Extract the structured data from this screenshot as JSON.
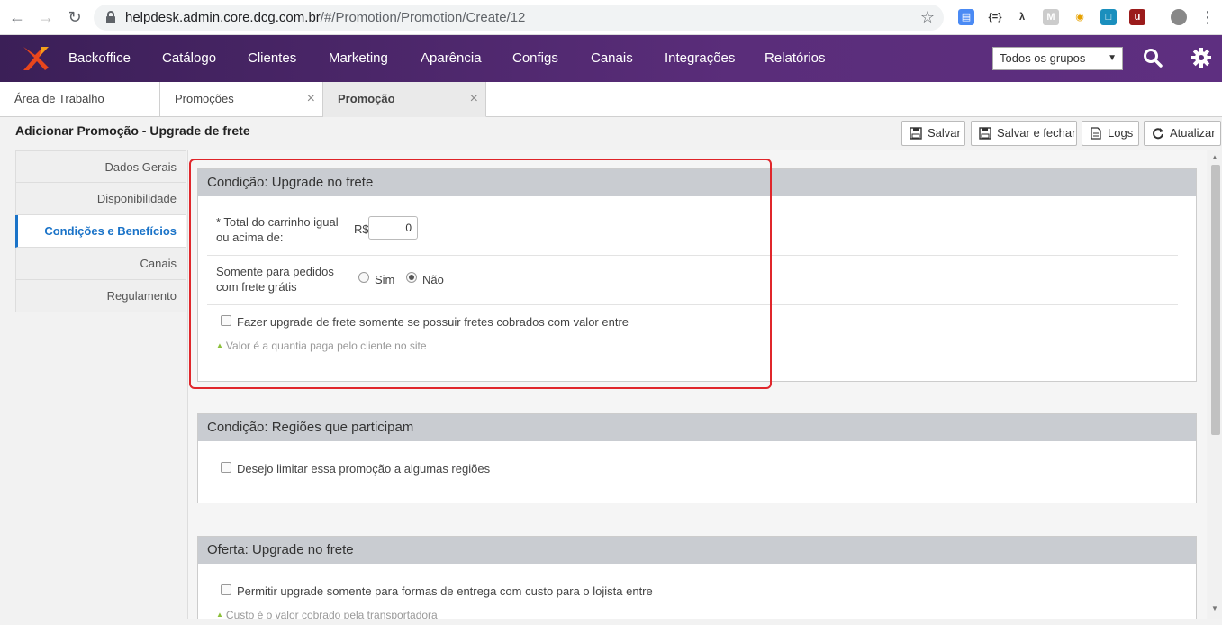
{
  "browser": {
    "url_host": "helpdesk.admin.core.dcg.com.br",
    "url_path": "/#/Promotion/Promotion/Create/12"
  },
  "header": {
    "menu": [
      "Backoffice",
      "Catálogo",
      "Clientes",
      "Marketing",
      "Aparência",
      "Configs",
      "Canais",
      "Integrações",
      "Relatórios"
    ],
    "group_select": "Todos os grupos",
    "brand_color": "#5a2d7a"
  },
  "tabs": [
    {
      "label": "Área de Trabalho"
    },
    {
      "label": "Promoções",
      "close": "×"
    },
    {
      "label": "Promoção",
      "close": "×"
    }
  ],
  "page": {
    "title": "Adicionar Promoção - Upgrade de frete",
    "toolbar": {
      "save": "Salvar",
      "save_close": "Salvar e fechar",
      "logs": "Logs",
      "refresh": "Atualizar"
    }
  },
  "sidebar": {
    "items": [
      {
        "label": "Dados Gerais"
      },
      {
        "label": "Disponibilidade"
      },
      {
        "label": "Condições e Benefícios",
        "active": true
      },
      {
        "label": "Canais"
      },
      {
        "label": "Regulamento"
      }
    ]
  },
  "panels": {
    "cond_frete": {
      "title": "Condição: Upgrade no frete",
      "total_label_1": "* Total do carrinho igual",
      "total_label_2": "ou acima de:",
      "currency": "R$",
      "total_value": "0",
      "free_label_1": "Somente para pedidos",
      "free_label_2": "com frete grátis",
      "opt_yes": "Sim",
      "opt_no": "Não",
      "selected": "Não",
      "checkbox_label": "Fazer upgrade de frete somente se possuir fretes cobrados com valor entre",
      "hint": "Valor é a quantia paga pelo cliente no site"
    },
    "cond_regioes": {
      "title": "Condição: Regiões que participam",
      "checkbox_label": "Desejo limitar essa promoção a algumas regiões"
    },
    "oferta": {
      "title": "Oferta: Upgrade no frete",
      "checkbox_label": "Permitir upgrade somente para formas de entrega com custo para o lojista entre",
      "hint": "Custo é o valor cobrado pela transportadora"
    }
  }
}
